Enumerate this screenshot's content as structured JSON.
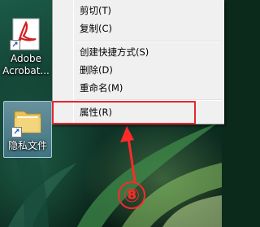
{
  "desktop_icons": {
    "acrobat": {
      "line1": "Adobe",
      "line2": "Acrobat..."
    },
    "folder": {
      "label": "隐私文件"
    }
  },
  "context_menu": {
    "items": [
      {
        "label": "剪切(T)"
      },
      {
        "label": "复制(C)"
      },
      {
        "label": "创建快捷方式(S)"
      },
      {
        "label": "删除(D)"
      },
      {
        "label": "重命名(M)"
      },
      {
        "label": "属性(R)"
      }
    ]
  },
  "annotation": {
    "step": "⑧",
    "color": "#ff2a2a"
  }
}
